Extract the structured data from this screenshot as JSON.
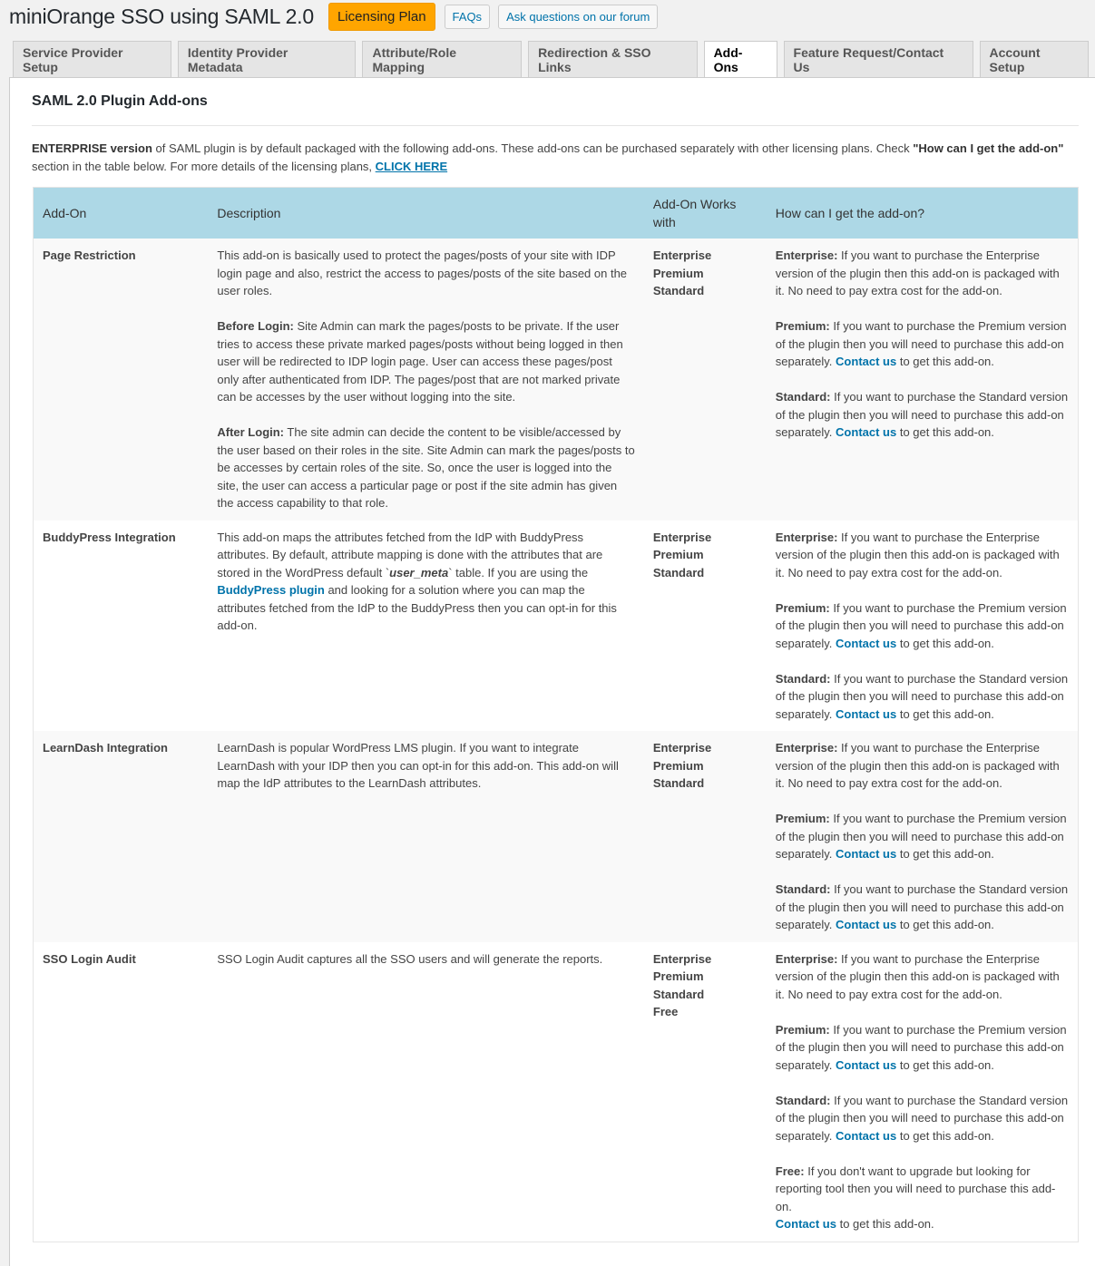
{
  "header": {
    "title": "miniOrange SSO using SAML 2.0",
    "licensing_button": "Licensing Plan",
    "faqs_button": "FAQs",
    "forum_button": "Ask questions on our forum"
  },
  "tabs": [
    {
      "label": "Service Provider Setup",
      "active": false
    },
    {
      "label": "Identity Provider Metadata",
      "active": false
    },
    {
      "label": "Attribute/Role Mapping",
      "active": false
    },
    {
      "label": "Redirection & SSO Links",
      "active": false
    },
    {
      "label": "Add-Ons",
      "active": true
    },
    {
      "label": "Feature Request/Contact Us",
      "active": false
    },
    {
      "label": "Account Setup",
      "active": false
    }
  ],
  "section": {
    "title": "SAML 2.0 Plugin Add-ons",
    "intro_bold": "ENTERPRISE version",
    "intro_text_1": " of SAML plugin is by default packaged with the following add-ons. These add-ons can be purchased separately with other licensing plans. Check ",
    "intro_bold_2": "\"How can I get the add-on\"",
    "intro_text_2": " section in the table below. For more details of the licensing plans, ",
    "intro_link": "CLICK HERE"
  },
  "table": {
    "headers": [
      "Add-On",
      "Description",
      "Add-On Works with",
      "How can I get the add-on?"
    ],
    "common": {
      "enterprise_label": "Enterprise:",
      "enterprise_text": " If you want to purchase the Enterprise version of the plugin then this add-on is packaged with it. No need to pay extra cost for the add-on.",
      "premium_label": "Premium:",
      "premium_text": " If you want to purchase the Premium version of the plugin then you will need to purchase this add-on separately. ",
      "standard_label": "Standard:",
      "standard_text": " If you want to purchase the Standard version of the plugin then you will need to purchase this add-on separately. ",
      "contact_link": "Contact us",
      "contact_suffix": " to get this add-on.",
      "free_label": "Free:",
      "free_text": " If you don't want to upgrade but looking for reporting tool then you will need to purchase this add-on."
    },
    "rows": [
      {
        "name": "Page Restriction",
        "desc_intro": "This add-on is basically used to protect the pages/posts of your site with IDP login page and also, restrict the access to pages/posts of the site based on the user roles.",
        "before_label": "Before Login:",
        "before_text": " Site Admin can mark the pages/posts to be private. If the user tries to access these private marked pages/posts without being logged in then user will be redirected to IDP login page. User can access these pages/post only after authenticated from IDP. The pages/post that are not marked private can be accesses by the user without logging into the site.",
        "after_label": "After Login:",
        "after_text": " The site admin can decide the content to be visible/accessed by the user based on their roles in the site. Site Admin can mark the pages/posts to be accesses by certain roles of the site. So, once the user is logged into the site, the user can access a particular page or post if the site admin has given the access capability to that role.",
        "works_with": [
          "Enterprise",
          "Premium",
          "Standard"
        ]
      },
      {
        "name": "BuddyPress Integration",
        "desc_1": "This add-on maps the attributes fetched from the IdP with BuddyPress attributes. By default, attribute mapping is done with the attributes that are stored in the WordPress default `",
        "desc_code": "user_meta",
        "desc_2": "` table. If you are using the ",
        "desc_link": "BuddyPress plugin",
        "desc_3": " and looking for a solution where you can map the attributes fetched from the IdP to the BuddyPress then you can opt-in for this add-on.",
        "works_with": [
          "Enterprise",
          "Premium",
          "Standard"
        ]
      },
      {
        "name": "LearnDash Integration",
        "desc": "LearnDash is popular WordPress LMS plugin. If you want to integrate LearnDash with your IDP then you can opt-in for this add-on. This add-on will map the IdP attributes to the LearnDash attributes.",
        "works_with": [
          "Enterprise",
          "Premium",
          "Standard"
        ]
      },
      {
        "name": "SSO Login Audit",
        "desc": "SSO Login Audit captures all the SSO users and will generate the reports.",
        "works_with": [
          "Enterprise",
          "Premium",
          "Standard",
          "Free"
        ]
      }
    ]
  },
  "colors": {
    "licensing_button": "#ffa500",
    "link": "#0073aa",
    "table_header": "#add8e6",
    "row_alt": "#f9f9f9"
  }
}
